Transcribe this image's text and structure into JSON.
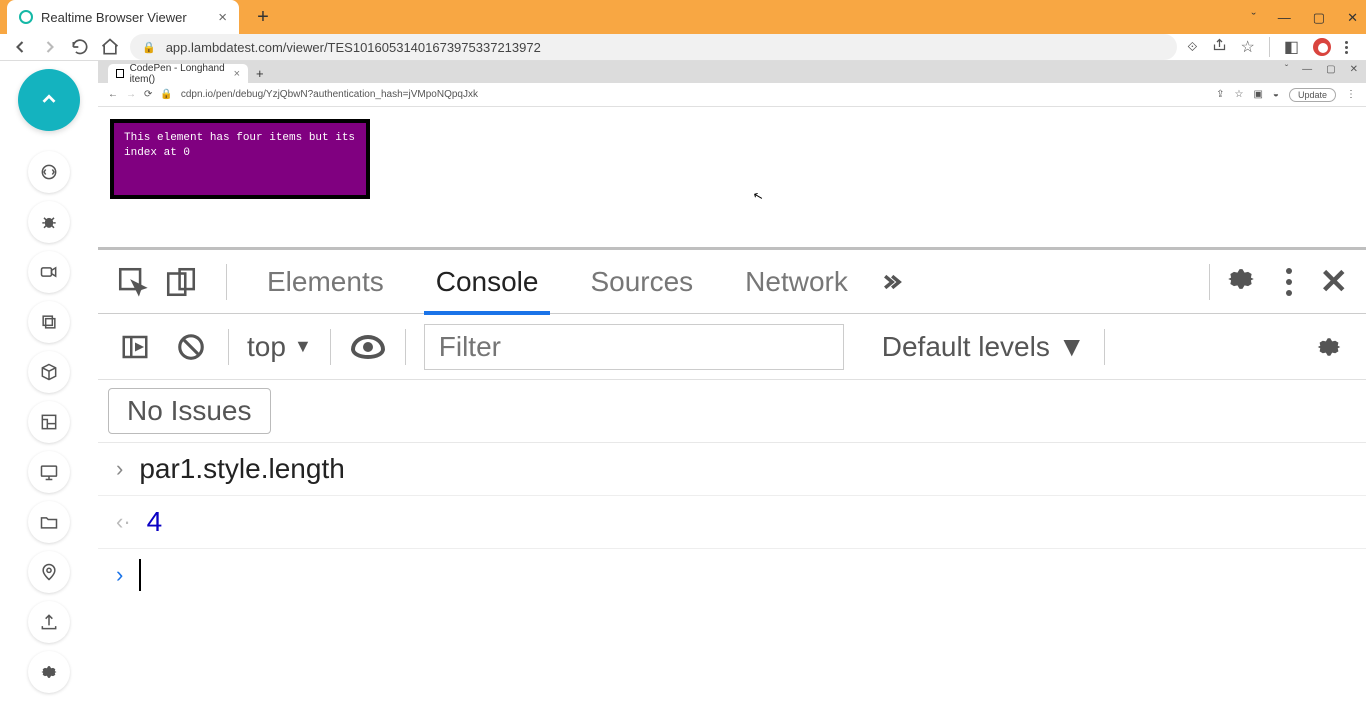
{
  "outer": {
    "tab_title": "Realtime Browser Viewer",
    "url": "app.lambdatest.com/viewer/TES101605314016739753372139​72"
  },
  "inner": {
    "tab_title": "CodePen - Longhand item()",
    "url": "cdpn.io/pen/debug/YzjQbwN?authentication_hash=jVMpoNQpqJxk",
    "update_btn": "Update"
  },
  "box_text": "This element has four items but its\nindex at 0",
  "devtools": {
    "tabs": {
      "elements": "Elements",
      "console": "Console",
      "sources": "Sources",
      "network": "Network"
    },
    "context": "top",
    "filter_placeholder": "Filter",
    "levels": "Default levels",
    "issues": "No Issues",
    "code": "par1.style.length",
    "result": "4"
  }
}
